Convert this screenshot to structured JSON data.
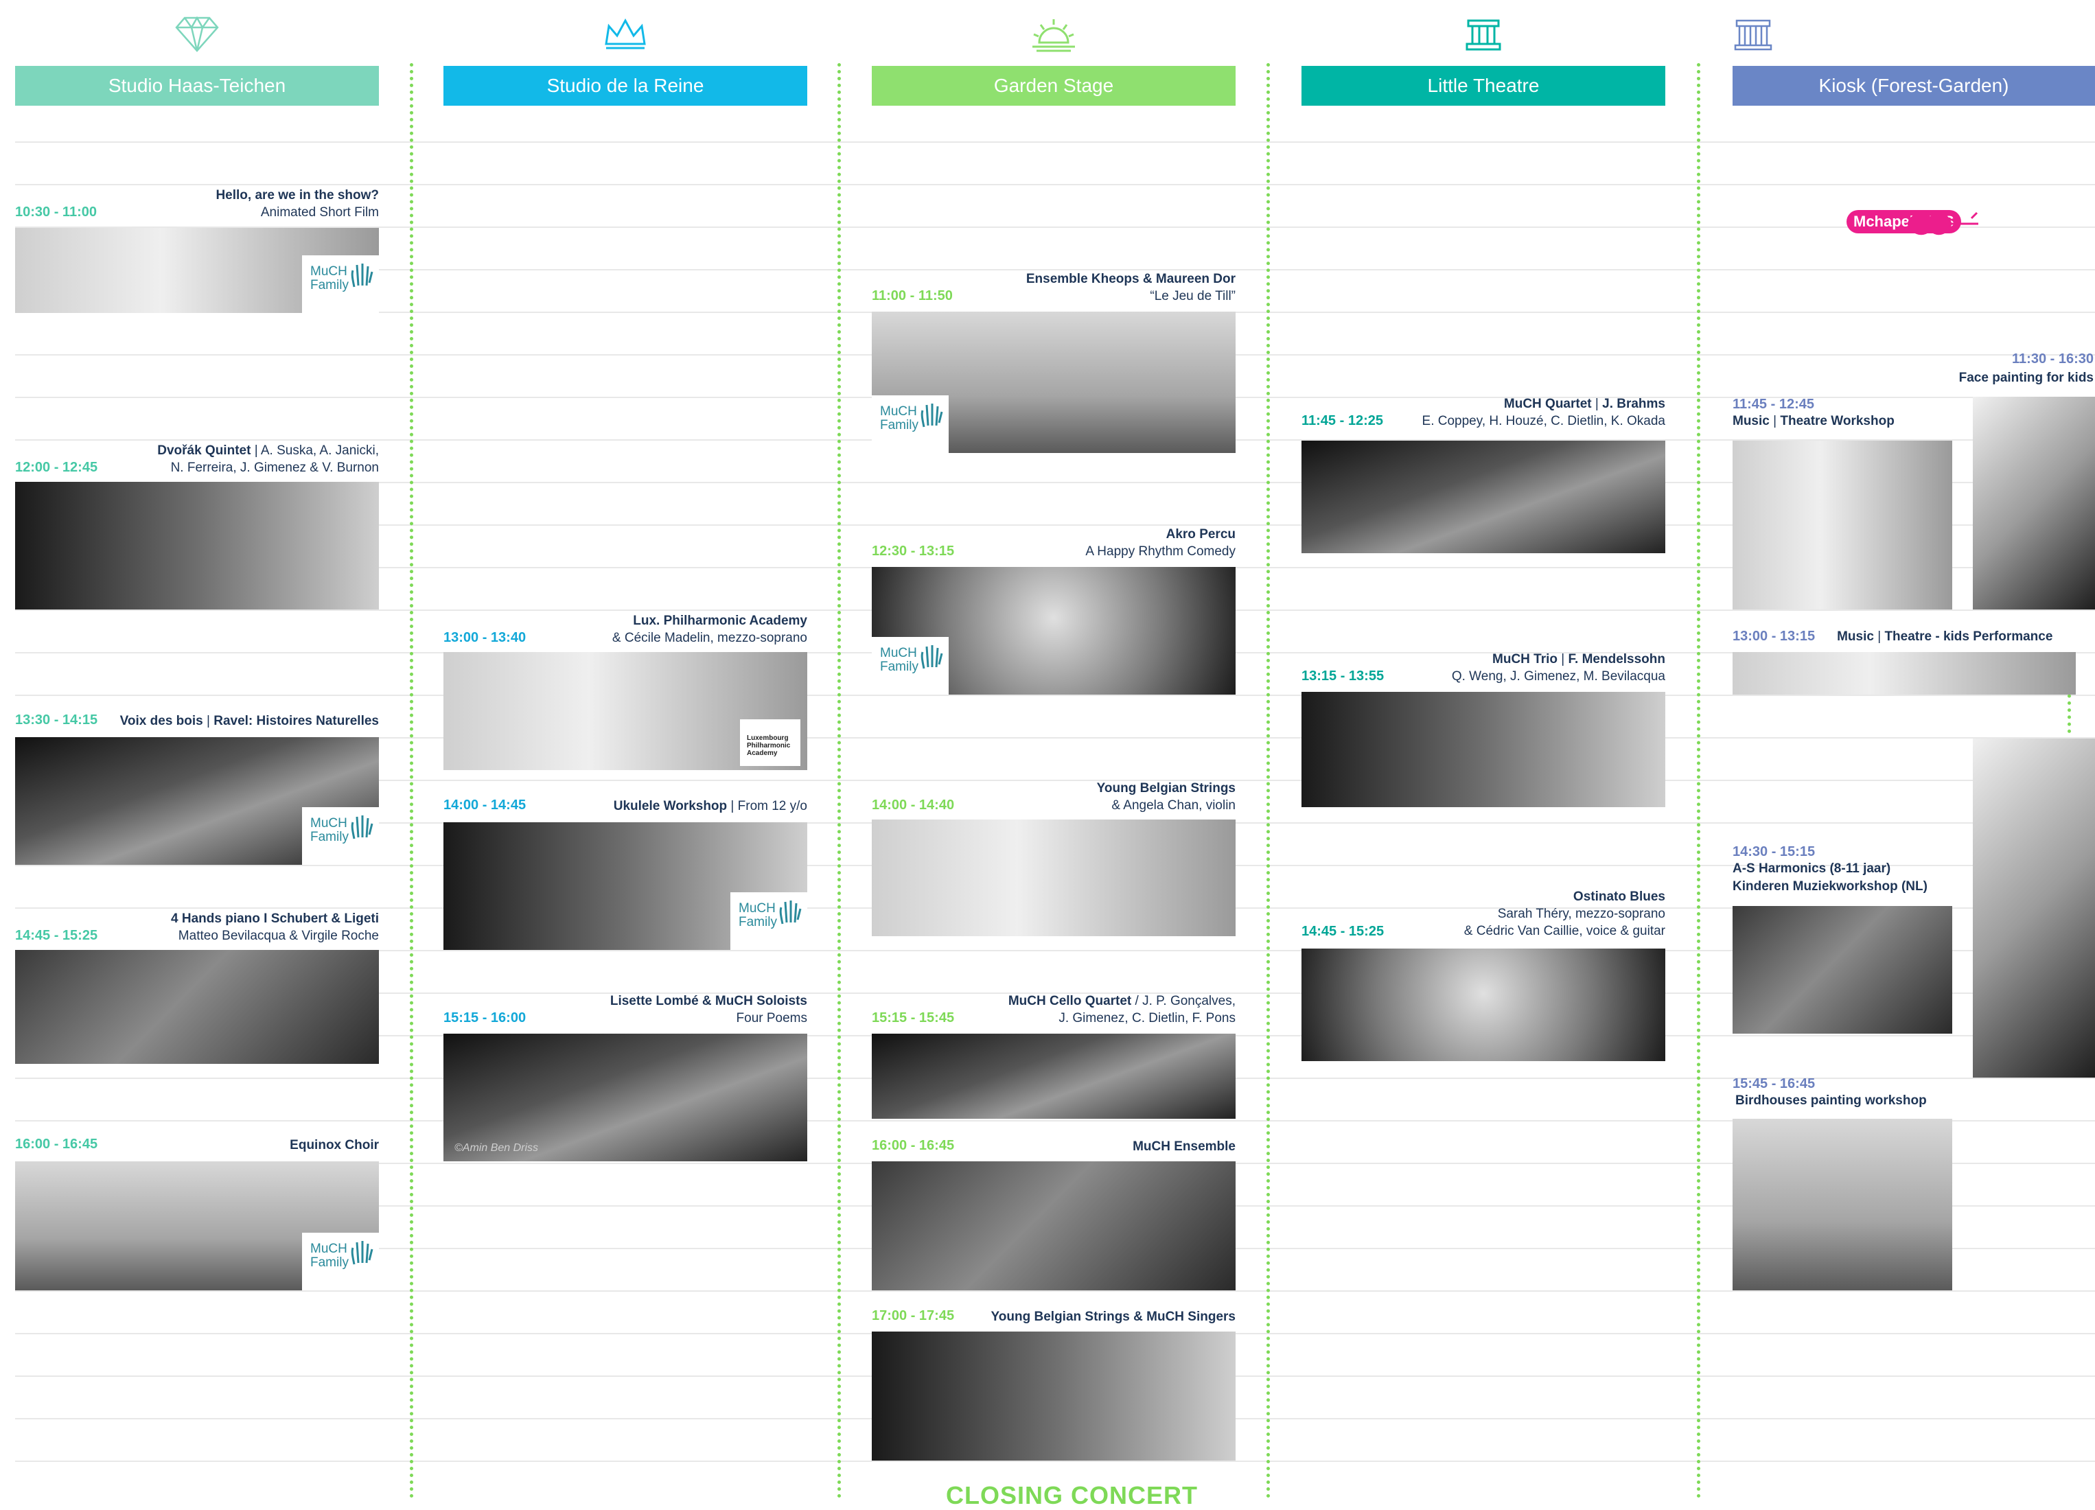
{
  "colors": {
    "studio_haas": "#7dd6bc",
    "studio_reine": "#12b9e8",
    "garden": "#8fe06f",
    "little_theatre": "#00b5a5",
    "kiosk": "#6a86c6",
    "time_haas": "#45c8a5",
    "time_reine": "#12a8d8",
    "time_garden": "#7ed957",
    "time_theatre": "#00a596",
    "time_kiosk": "#6a7fbe"
  },
  "columns": [
    {
      "header": "Studio Haas-Teichen",
      "icon": "diamond-icon",
      "events": [
        {
          "time": "10:30 - 11:00",
          "title": "Hello, are we in the show?",
          "sub": "Animated Short Film",
          "badge": "MuCH Family"
        },
        {
          "time": "12:00 - 12:45",
          "title": "Dvořák Quintet",
          "sub": " | A. Suska, A. Janicki,",
          "sub2": "N. Ferreira, J. Gimenez & V. Burnon"
        },
        {
          "time": "13:30 - 14:15",
          "title": "Voix des bois",
          "sub": " | ",
          "title2": "Ravel: Histoires Naturelles",
          "badge": "MuCH Family"
        },
        {
          "time": "14:45 - 15:25",
          "title": "4 Hands piano I Schubert & Ligeti",
          "sub2": "Matteo Bevilacqua & Virgile Roche"
        },
        {
          "time": "16:00 - 16:45",
          "title": "Equinox Choir",
          "badge": "MuCH Family"
        }
      ]
    },
    {
      "header": "Studio de la Reine",
      "icon": "crown-icon",
      "events": [
        {
          "time": "13:00 - 13:40",
          "title": "Lux. Philharmonic Academy",
          "sub2": "& Cécile Madelin, mezzo-soprano",
          "logo": "Luxembourg Philharmonic Academy"
        },
        {
          "time": "14:00 - 14:45",
          "title": "Ukulele Workshop",
          "sub": " | From 12 y/o",
          "badge": "MuCH Family"
        },
        {
          "time": "15:15 - 16:00",
          "title": "Lisette Lombé & MuCH Soloists",
          "sub2": "Four Poems",
          "credit": "©Amin Ben Driss"
        }
      ]
    },
    {
      "header": "Garden Stage",
      "icon": "sunrise-icon",
      "events": [
        {
          "time": "11:00 - 11:50",
          "title": "Ensemble Kheops & Maureen Dor",
          "sub2": "“Le Jeu de Till”",
          "badge": "MuCH Family"
        },
        {
          "time": "12:30 - 13:15",
          "title": "Akro Percu",
          "sub2": "A Happy Rhythm Comedy",
          "badge": "MuCH Family"
        },
        {
          "time": "14:00 - 14:40",
          "title": "Young Belgian Strings",
          "sub2": "& Angela Chan, violin"
        },
        {
          "time": "15:15 - 15:45",
          "title": "MuCH Cello Quartet",
          "sub": " / J. P. Gonçalves,",
          "sub2": "J. Gimenez, C. Dietlin, F. Pons"
        },
        {
          "time": "16:00 - 16:45",
          "title": "MuCH Ensemble"
        },
        {
          "time": "17:00 - 17:45",
          "title": "Young Belgian Strings & MuCH Singers"
        }
      ],
      "closing": "CLOSING CONCERT"
    },
    {
      "header": "Little Theatre",
      "icon": "pillar-icon",
      "events": [
        {
          "time": "11:45 - 12:25",
          "title": "MuCH Quartet",
          "sub": " | ",
          "title2": "J. Brahms",
          "sub2": "E. Coppey, H. Houzé, C. Dietlin, K. Okada"
        },
        {
          "time": "13:15 - 13:55",
          "title": "MuCH Trio",
          "sub": " | ",
          "title2": "F. Mendelssohn",
          "sub2": "Q. Weng, J. Gimenez, M. Bevilacqua"
        },
        {
          "time": "14:45 - 15:25",
          "title": "Ostinato Blues",
          "sub2": "Sarah Théry, mezzo-soprano",
          "sub3": "& Cédric Van Caillie, voice & guitar"
        }
      ]
    },
    {
      "header": "Kiosk (Forest-Garden)",
      "icon": "kiosk-icon",
      "kids_logo": "Mchapel KIDS",
      "side_event": {
        "time": "11:30 - 16:30",
        "title": "Face painting for kids"
      },
      "events": [
        {
          "time": "11:45 - 12:45",
          "title": "Music",
          "sub": " | ",
          "title2": "Theatre Workshop"
        },
        {
          "time": "13:00 - 13:15",
          "title": "Music",
          "sub": " | ",
          "title2": "Theatre - kids Performance"
        },
        {
          "time": "14:30 - 15:15",
          "title": "A-S Harmonics (8-11 jaar)",
          "title2": "Kinderen Muziekworkshop (NL)"
        },
        {
          "time": "15:45 - 16:45",
          "title": "Birdhouses painting workshop"
        }
      ]
    }
  ],
  "badge_line1": "MuCH",
  "badge_line2": "Family"
}
